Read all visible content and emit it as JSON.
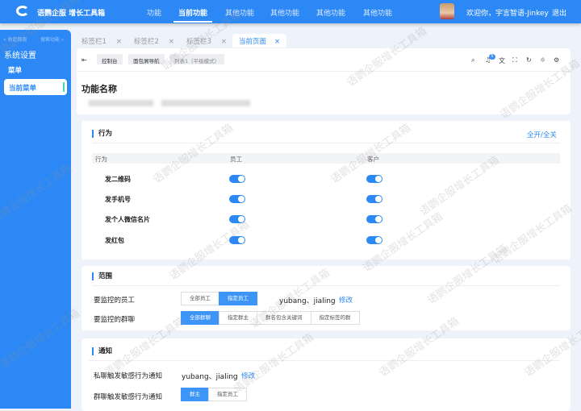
{
  "header": {
    "brand": "语鹦企服 增长工具箱",
    "nav": [
      "功能",
      "当前功能",
      "其他功能",
      "其他功能",
      "其他功能",
      "其他功能"
    ],
    "welcome": "欢迎你，宇言智语-Jinkey",
    "logout": "退出"
  },
  "sidebar": {
    "collapse": "收起面板",
    "search": "搜索功能",
    "title": "系统设置",
    "menu": "菜单",
    "current": "当前菜单"
  },
  "tabs": [
    "标签栏1",
    "标签栏2",
    "标签栏3",
    "当前页面"
  ],
  "breadcrumb": [
    "控制台",
    "面包屑导航",
    "列表1（平级模式）"
  ],
  "toolbar": {
    "notification_count": "5"
  },
  "page": {
    "title": "功能名称"
  },
  "behavior": {
    "title": "行为",
    "toggle_all": "全开/全关",
    "columns": [
      "行为",
      "员工",
      "客户"
    ],
    "rows": [
      {
        "label": "发二维码",
        "employee": true,
        "customer": true
      },
      {
        "label": "发手机号",
        "employee": true,
        "customer": true
      },
      {
        "label": "发个人微信名片",
        "employee": true,
        "customer": true
      },
      {
        "label": "发红包",
        "employee": true,
        "customer": true
      }
    ]
  },
  "scope": {
    "title": "范围",
    "employee_label": "要监控的员工",
    "employee_options": [
      "全部员工",
      "指定员工"
    ],
    "employee_selected": 1,
    "employee_value": "yubang、jialing",
    "edit": "修改",
    "group_label": "要监控的群聊",
    "group_options": [
      "全部群聊",
      "指定群主",
      "群名包含关键词",
      "指定标签的群"
    ],
    "group_selected": 0
  },
  "notify": {
    "title": "通知",
    "private_label": "私聊触发敏感行为通知",
    "private_value": "yubang、jialing",
    "edit": "修改",
    "group_label": "群聊触发敏感行为通知",
    "group_options": [
      "群主",
      "指定员工"
    ],
    "group_selected": 0
  },
  "watermark": "语鹦企服增长工具箱"
}
